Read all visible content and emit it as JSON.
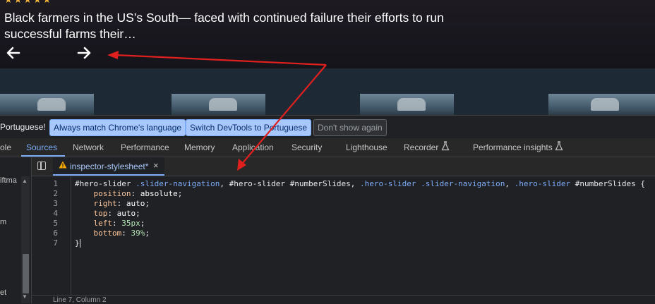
{
  "hero": {
    "stars": "★★★★★",
    "text": "Black farmers in the US’s South— faced with continued failure their efforts to run successful farms their…",
    "prev_icon": "arrow-left-icon",
    "next_icon": "arrow-right-icon"
  },
  "infobar": {
    "message": "Portuguese!",
    "buttons": [
      "Always match Chrome's language",
      "Switch DevTools to Portuguese",
      "Don't show again"
    ]
  },
  "devtools_tabs": [
    {
      "label": "ole"
    },
    {
      "label": "Sources"
    },
    {
      "label": "Network"
    },
    {
      "label": "Performance"
    },
    {
      "label": "Memory"
    },
    {
      "label": "Application"
    },
    {
      "label": "Security"
    },
    {
      "label": "Lighthouse"
    },
    {
      "label": "Recorder"
    },
    {
      "label": "Performance insights"
    }
  ],
  "left_panel": {
    "labels": [
      "iftma",
      "m",
      "et"
    ]
  },
  "editor_tab": {
    "name": "inspector-stylesheet*",
    "close": "×"
  },
  "code": {
    "line_numbers": [
      "1",
      "2",
      "3",
      "4",
      "5",
      "6",
      "7"
    ],
    "selector": {
      "id1": "#hero-slider",
      "cls1": " .slider-navigation",
      "sep1": ", ",
      "id2": "#hero-slider",
      "sp2": " ",
      "id2b": "#numberSlides",
      "sep2": ", ",
      "cls3": ".hero-slider .slider-navigation",
      "sep3": ", ",
      "cls4": ".hero-slider",
      "sp4": " ",
      "id4": "#numberSlides",
      "brace": " {"
    },
    "decls": [
      {
        "prop": "position",
        "val": "absolute"
      },
      {
        "prop": "right",
        "val": "auto"
      },
      {
        "prop": "top",
        "val": "auto"
      },
      {
        "prop": "left",
        "val": "35px"
      },
      {
        "prop": "bottom",
        "val": "39%"
      }
    ],
    "close": "}"
  },
  "status": {
    "text": "Line 7, Column 2"
  },
  "colors": {
    "accent": "#7cacf8",
    "annotation": "#e0201e",
    "star": "#f6b63a"
  }
}
